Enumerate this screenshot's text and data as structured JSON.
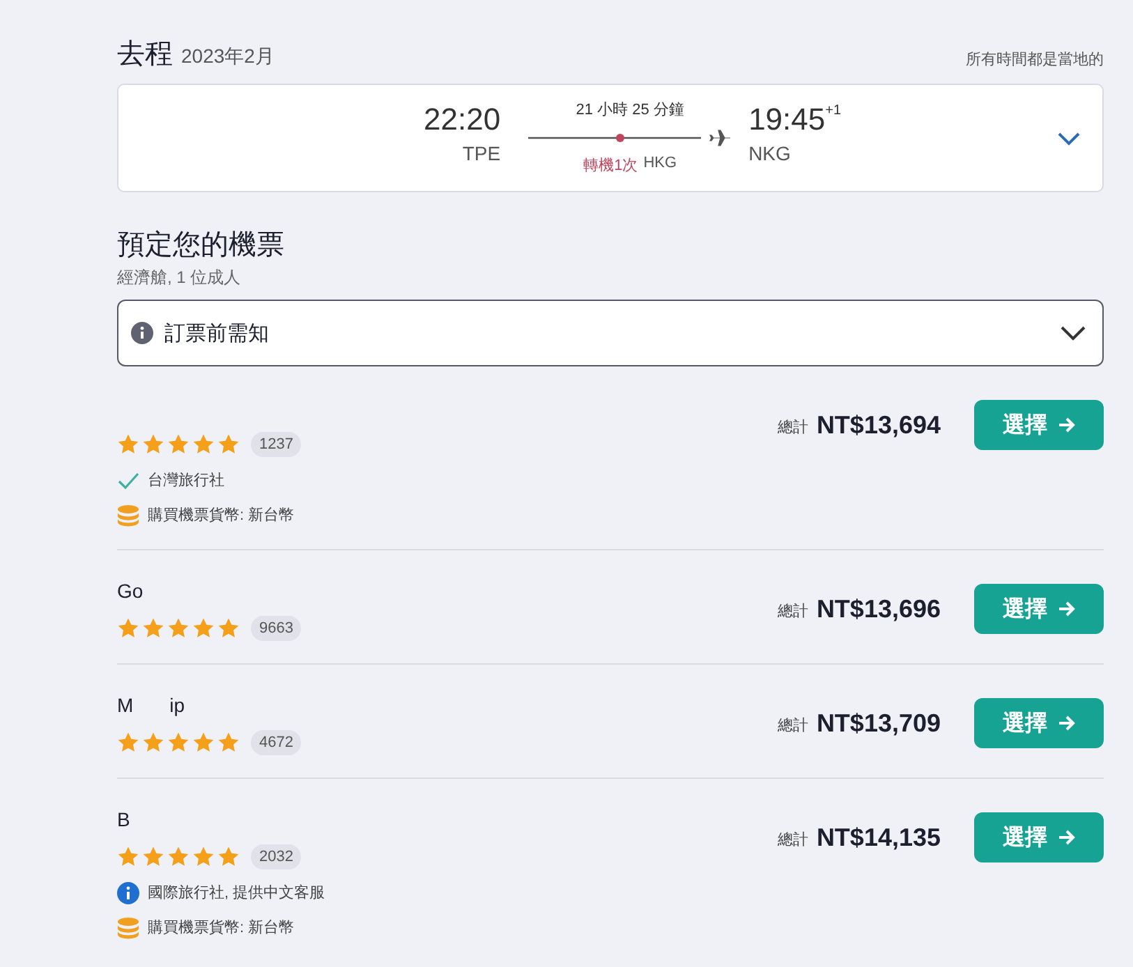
{
  "outbound": {
    "title": "去程",
    "date": "2023年2月",
    "note": "所有時間都是當地的"
  },
  "flight": {
    "depart_time": "22:20",
    "depart_airport": "TPE",
    "duration": "21 小時 25 分鐘",
    "stops": "轉機1次",
    "via": "HKG",
    "arrive_time": "19:45",
    "day_offset": "+1",
    "arrive_airport": "NKG",
    "expanded": false
  },
  "booking": {
    "title": "預定您的機票",
    "subtitle": "經濟艙, 1 位成人",
    "notice": {
      "label": "訂票前需知",
      "expanded": false
    }
  },
  "providers": [
    {
      "stars": 5,
      "reviews": "1237",
      "price_label": "總計",
      "price": "NT$13,694",
      "button": "選擇",
      "features": [
        {
          "kind": "check",
          "text": "台灣旅行社"
        },
        {
          "kind": "currency",
          "text": "購買機票貨幣: 新台幣"
        }
      ]
    },
    {
      "name_parts": [
        "Go"
      ],
      "stars": 5,
      "reviews": "9663",
      "price_label": "總計",
      "price": "NT$13,696",
      "button": "選擇"
    },
    {
      "name_parts": [
        "M",
        "ip"
      ],
      "stars": 5,
      "reviews": "4672",
      "price_label": "總計",
      "price": "NT$13,709",
      "button": "選擇"
    },
    {
      "name_parts": [
        "B"
      ],
      "stars": 5,
      "reviews": "2032",
      "price_label": "總計",
      "price": "NT$14,135",
      "button": "選擇",
      "features": [
        {
          "kind": "info",
          "text": "國際旅行社, 提供中文客服"
        },
        {
          "kind": "currency",
          "text": "購買機票貨幣: 新台幣"
        }
      ]
    }
  ]
}
